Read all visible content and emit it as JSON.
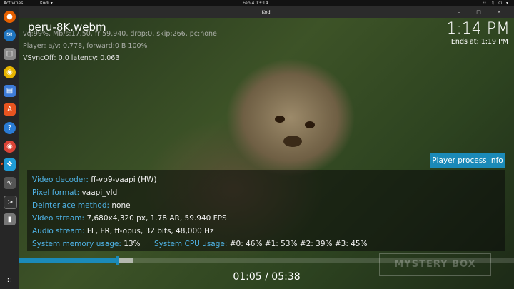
{
  "topbar": {
    "activities": "Activities",
    "app": "Kodi ▾",
    "clock": "Feb 4  13:14",
    "sys": "☷ ♫ ⏻ ▾"
  },
  "window": {
    "title": "Kodi",
    "controls": "– □ ✕"
  },
  "osd": {
    "filename": "peru-8K.webm",
    "debug1": "vq:99%, Mb/s:17.50, fr:59.940, drop:0, skip:266, pc:none",
    "debug2": "Player: a/v: 0.778,  forward:0 B 100%",
    "debug3": "VSyncOff: 0.0 latency: 0.063",
    "time": "1:14 PM",
    "ends_at": "Ends at: 1:19 PM",
    "info_button": "Player process info",
    "progress_fraction": 0.197,
    "buffer_fraction": 0.23,
    "timecode": "01:05 / 05:38",
    "watermark": "MYSTERY BOX"
  },
  "info": {
    "video_decoder": {
      "label": "Video decoder:",
      "value": "ff-vp9-vaapi (HW)"
    },
    "pixel_format": {
      "label": "Pixel format:",
      "value": "vaapi_vld"
    },
    "deinterlace": {
      "label": "Deinterlace method:",
      "value": "none"
    },
    "video_stream": {
      "label": "Video stream:",
      "value": "7,680x4,320 px, 1.78 AR, 59.940 FPS"
    },
    "audio_stream": {
      "label": "Audio stream:",
      "value": "FL, FR, ff-opus, 32 bits, 48,000 Hz"
    },
    "memory": {
      "label": "System memory usage:",
      "value": "13%"
    },
    "cpu": {
      "label": "System CPU usage:",
      "value": "#0:  46% #1:  53% #2:  39% #3:  45%"
    }
  }
}
